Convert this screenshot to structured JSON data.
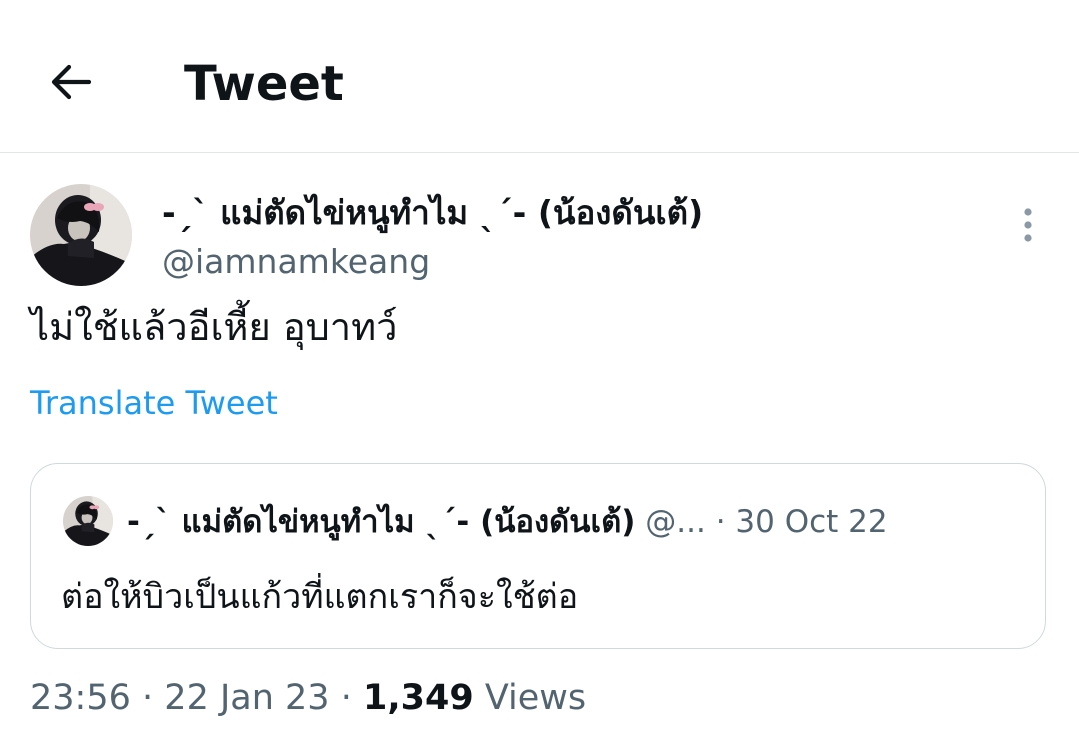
{
  "header": {
    "title": "Tweet"
  },
  "tweet": {
    "author": {
      "display_name": "-ˏˋ แม่ตัดไข่หนูทำไม ˎˊ- (น้องดันเต้)",
      "handle": "@iamnamkeang"
    },
    "text": "ไม่ใช้แล้วอีเหี้ย อุบาทว์",
    "translate_label": "Translate Tweet",
    "quoted": {
      "display_name": "-ˏˋ แม่ตัดไข่หนูทำไม ˎˊ- (น้องดันเต้)",
      "handle_truncated": "@...",
      "separator": "·",
      "date": "30 Oct 22",
      "text": "ต่อให้บิวเป็นแก้วที่แตกเราก็จะใช้ต่อ"
    },
    "meta": {
      "time": "23:56",
      "sep1": "·",
      "date": "22 Jan 23",
      "sep2": "·",
      "views_count": "1,349",
      "views_label": "Views"
    }
  },
  "icons": {
    "back": "arrow-left-icon",
    "more": "more-vertical-icon"
  },
  "colors": {
    "accent": "#1d9bf0",
    "text_primary": "#0f1419",
    "text_secondary": "#536471",
    "border": "#cfd9de"
  }
}
